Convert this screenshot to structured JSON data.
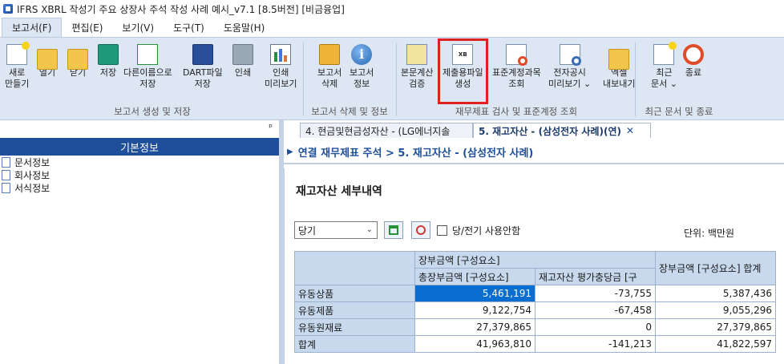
{
  "window": {
    "title": "IFRS XBRL 작성기 주요 상장사 주석 작성 사례 예시_v7.1 [8.5버전] [비금융업]"
  },
  "menu": [
    {
      "label": "보고서(F)"
    },
    {
      "label": "편집(E)"
    },
    {
      "label": "보기(V)"
    },
    {
      "label": "도구(T)"
    },
    {
      "label": "도움말(H)"
    }
  ],
  "ribbon": {
    "buttons": {
      "new": "새로\n만들기",
      "open": "열기",
      "close": "닫기",
      "save": "저장",
      "save_as": "다른이름으로\n저장",
      "dart_save": "DART파일\n저장",
      "print": "인쇄",
      "print_preview": "인쇄\n미리보기",
      "report_delete": "보고서\n삭제",
      "report_info": "보고서\n정보",
      "verify": "본문계산\n검증",
      "submit_file": "제출용파일\n생성",
      "std_account": "표준계정과목\n조회",
      "e_disclosure": "전자공시\n미리보기 ⌄",
      "excel_export": "엑셀\n내보내기",
      "recent_docs": "최근\n문서 ⌄",
      "exit": "종료"
    },
    "groups": {
      "g1": "보고서 생성 및 저장",
      "g2": "보고서 삭제 및 정보",
      "g3": "재무제표 검사 및 표준계정 조회",
      "g4": "최근 문서 및 종료"
    }
  },
  "left_panel": {
    "pin": "ᵖ",
    "header": "기본정보",
    "items": [
      "문서정보",
      "회사정보",
      "서식정보"
    ]
  },
  "tabs": [
    {
      "label": "4. 현금및현금성자산 - (LG에너지솔"
    },
    {
      "label": "5. 재고자산 - (삼성전자 사례)(연)",
      "active": true
    }
  ],
  "tab_close": "✕",
  "breadcrumb": {
    "arrow": "▶",
    "text": "연결 재무제표 주석 > 5. 재고자산 - (삼성전자 사례)"
  },
  "main": {
    "title": "재고자산 세부내역",
    "period_select": "당기",
    "checkbox_label": "당/전기 사용안함",
    "unit": "단위:  백만원"
  },
  "table": {
    "header_group": "장부금액 [구성요소]",
    "col1": "총장부금액 [구성요소]",
    "col2": "재고자산 평가충당금 [구",
    "col3": "장부금액 [구성요소] 합계",
    "rows": [
      {
        "label": "유동상품",
        "c1": "5,461,191",
        "c2": "-73,755",
        "c3": "5,387,436"
      },
      {
        "label": "유동제품",
        "c1": "9,122,754",
        "c2": "-67,458",
        "c3": "9,055,296"
      },
      {
        "label": "유동원재료",
        "c1": "27,379,865",
        "c2": "0",
        "c3": "27,379,865"
      },
      {
        "label": "합계",
        "c1": "41,963,810",
        "c2": "-141,213",
        "c3": "41,822,597"
      }
    ]
  },
  "colors": {
    "accent": "#1f4e9a",
    "ribbon_bg": "#dde6f3",
    "highlight": "#e02020",
    "selected_cell": "#0a6ed1"
  }
}
